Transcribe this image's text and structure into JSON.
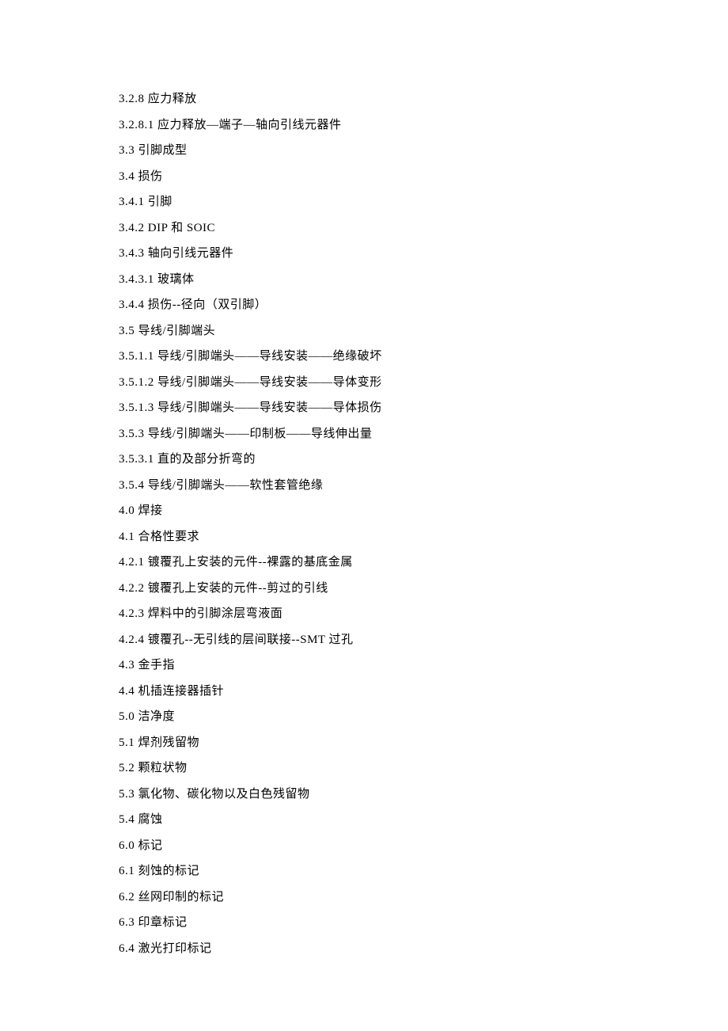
{
  "toc": [
    {
      "num": "3.2.8",
      "title": "应力释放"
    },
    {
      "num": "3.2.8.1",
      "title": "应力释放—端子—轴向引线元器件"
    },
    {
      "num": "3.3",
      "title": "引脚成型"
    },
    {
      "num": "3.4",
      "title": "损伤"
    },
    {
      "num": "3.4.1",
      "title": "引脚"
    },
    {
      "num": "3.4.2",
      "title": "DIP 和 SOIC"
    },
    {
      "num": "3.4.3",
      "title": "轴向引线元器件"
    },
    {
      "num": "3.4.3.1",
      "title": "玻璃体"
    },
    {
      "num": "3.4.4",
      "title": "损伤--径向（双引脚）"
    },
    {
      "num": "3.5",
      "title": "导线/引脚端头"
    },
    {
      "num": "3.5.1.1",
      "title": "导线/引脚端头——导线安装——绝缘破坏"
    },
    {
      "num": "3.5.1.2",
      "title": "导线/引脚端头——导线安装——导体变形"
    },
    {
      "num": "3.5.1.3",
      "title": "导线/引脚端头——导线安装——导体损伤"
    },
    {
      "num": "3.5.3",
      "title": "导线/引脚端头——印制板——导线伸出量"
    },
    {
      "num": "3.5.3.1",
      "title": "直的及部分折弯的"
    },
    {
      "num": "3.5.4",
      "title": "导线/引脚端头——软性套管绝缘"
    },
    {
      "num": "4.0",
      "title": "焊接"
    },
    {
      "num": "4.1",
      "title": "合格性要求"
    },
    {
      "num": "4.2.1",
      "title": "镀覆孔上安装的元件--裸露的基底金属"
    },
    {
      "num": "4.2.2",
      "title": "镀覆孔上安装的元件--剪过的引线"
    },
    {
      "num": "4.2.3",
      "title": "焊料中的引脚涂层弯液面"
    },
    {
      "num": "4.2.4",
      "title": "镀覆孔--无引线的层间联接--SMT 过孔"
    },
    {
      "num": "4.3",
      "title": "金手指"
    },
    {
      "num": "4.4",
      "title": "机插连接器插针"
    },
    {
      "num": "5.0",
      "title": "洁净度"
    },
    {
      "num": "5.1",
      "title": "焊剂残留物"
    },
    {
      "num": "5.2",
      "title": "颗粒状物"
    },
    {
      "num": "5.3",
      "title": "氯化物、碳化物以及白色残留物"
    },
    {
      "num": "5.4",
      "title": "腐蚀"
    },
    {
      "num": "6.0",
      "title": "标记"
    },
    {
      "num": "6.1",
      "title": "刻蚀的标记"
    },
    {
      "num": "6.2",
      "title": "丝网印制的标记"
    },
    {
      "num": "6.3",
      "title": "印章标记"
    },
    {
      "num": "6.4",
      "title": "激光打印标记"
    }
  ]
}
